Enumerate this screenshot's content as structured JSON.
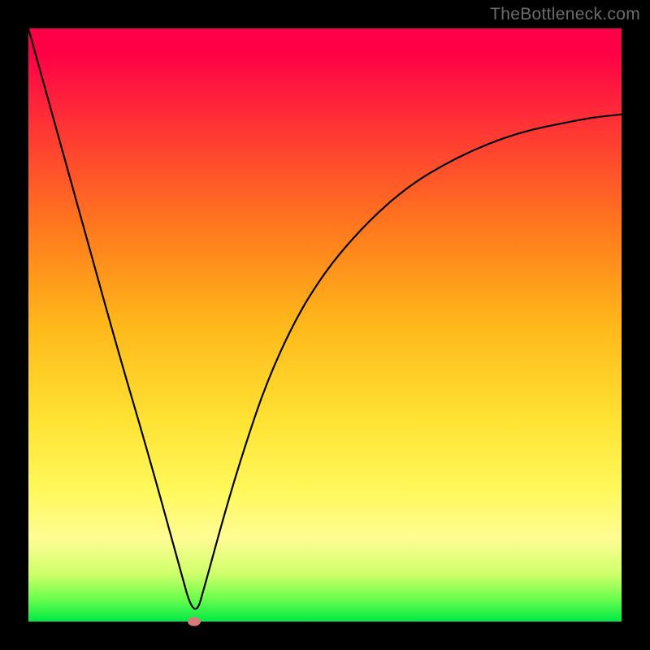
{
  "watermark": "TheBottleneck.com",
  "colors": {
    "frame": "#000000",
    "curve": "#000000",
    "marker": "#d87a7a",
    "gradient_top": "#ff0046",
    "gradient_bottom": "#00e845"
  },
  "chart_data": {
    "type": "line",
    "title": "",
    "xlabel": "",
    "ylabel": "",
    "xlim": [
      0,
      100
    ],
    "ylim": [
      0,
      100
    ],
    "grid": false,
    "legend": false,
    "series": [
      {
        "name": "curve",
        "x": [
          0,
          5,
          10,
          15,
          20,
          25,
          28,
          30,
          33,
          36,
          40,
          45,
          50,
          55,
          60,
          65,
          70,
          75,
          80,
          85,
          90,
          95,
          100
        ],
        "values": [
          100,
          82,
          64,
          46,
          29,
          11,
          0,
          7,
          18,
          28,
          40,
          51,
          59,
          65,
          70,
          74,
          77,
          79.5,
          81.5,
          83,
          84,
          85,
          85.5
        ]
      }
    ],
    "annotations": [
      {
        "name": "marker",
        "x": 28,
        "y": 0,
        "shape": "ellipse",
        "color": "#d87a7a"
      }
    ]
  }
}
